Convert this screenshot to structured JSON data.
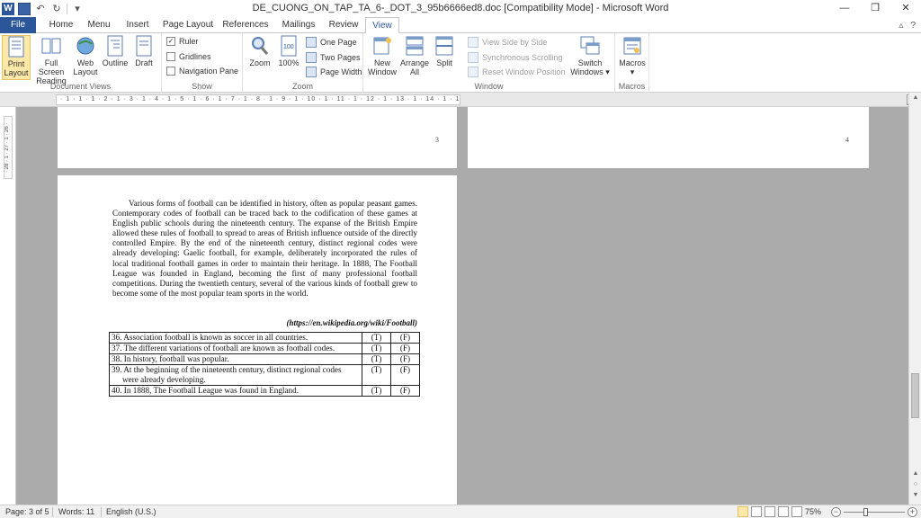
{
  "window": {
    "title": "DE_CUONG_ON_TAP_TA_6-_DOT_3_95b6666ed8.doc [Compatibility Mode] - Microsoft Word",
    "app_icon": "word-logo-icon",
    "app_letter": "W",
    "minimize": "—",
    "maximize": "❐",
    "close": "✕"
  },
  "tabs": {
    "file": "File",
    "home": "Home",
    "menu": "Menu",
    "insert": "Insert",
    "page_layout": "Page Layout",
    "references": "References",
    "mailings": "Mailings",
    "review": "Review",
    "view": "View"
  },
  "ribbon": {
    "document_views": {
      "label": "Document Views",
      "print_layout": [
        "Print",
        "Layout"
      ],
      "full_screen_reading": [
        "Full Screen",
        "Reading"
      ],
      "web_layout": [
        "Web",
        "Layout"
      ],
      "outline": "Outline",
      "draft": "Draft"
    },
    "show": {
      "label": "Show",
      "ruler": "Ruler",
      "ruler_checked": true,
      "gridlines": "Gridlines",
      "navigation_pane": "Navigation Pane"
    },
    "zoom": {
      "label": "Zoom",
      "zoom": "Zoom",
      "hundred": "100%",
      "one_page": "One Page",
      "two_pages": "Two Pages",
      "page_width": "Page Width"
    },
    "window": {
      "label": "Window",
      "new_window": [
        "New",
        "Window"
      ],
      "arrange_all": [
        "Arrange",
        "All"
      ],
      "split": "Split",
      "view_side_by_side": "View Side by Side",
      "synchronous_scrolling": "Synchronous Scrolling",
      "reset_window_position": "Reset Window Position",
      "switch_windows": [
        "Switch",
        "Windows ▾"
      ]
    },
    "macros": {
      "label": "Macros",
      "macros": "Macros",
      "dropdown": "▾"
    }
  },
  "ruler": {
    "text": "· 1 · 1 · 1 · 2 · 1 · 3 · 1 · 4 · 1 · 5 · 1 · 6 · 1 · 7 · 1 · 8 · 1 · 9 · 1 · 10 · 1 · 11 · 1 · 12 · 1 · 13 · 1 · 14 · 1 · 15 · 1 · 16 · 1 · 17 · 1 · 18 · 1 · 19 ·",
    "vertical": "· 28 · 1 · 27 · 1 · 26 ·"
  },
  "pages": {
    "page_3_number": "3",
    "page_4_number": "4"
  },
  "document": {
    "paragraph": "Various forms of football can be identified in history, often as popular peasant games. Contemporary codes of football can be traced back to the codification of these games at English public schools during the nineteenth century. The expanse of the British Empire allowed these rules of football to spread to areas of British influence outside of the directly controlled Empire. By the end of the nineteenth century, distinct regional codes were already developing: Gaelic football, for example, deliberately incorporated the rules of local traditional football games in order to maintain their heritage. In 1888, The Football League was founded in England, becoming the first of many professional football competitions. During the twentieth century, several of the various kinds of football grew to become some of the most popular team sports in the world.",
    "source": "(https://en.wikipedia.org/wiki/Football)",
    "questions": [
      {
        "text": "36. Association football is known as soccer in all countries.",
        "t": "(T)",
        "f": "(F)"
      },
      {
        "text": "37. The different variations of football are known as football codes.",
        "t": "(T)",
        "f": "(F)"
      },
      {
        "text": "38. In history, football was popular.",
        "t": "(T)",
        "f": "(F)"
      },
      {
        "text": "39. At the beginning of the nineteenth century, distinct regional codes were already developing.",
        "t": "(T)",
        "f": "(F)"
      },
      {
        "text": "40. In 1888, The Football League was found in England.",
        "t": "(T)",
        "f": "(F)"
      }
    ]
  },
  "status": {
    "page": "Page: 3 of 5",
    "words": "Words: 11",
    "language": "English (U.S.)",
    "zoom": "75%",
    "zoom_level_percent": 75
  },
  "colors": {
    "file_tab": "#2b579a",
    "canvas": "#ababab",
    "selected_button": "#fce8a8"
  }
}
